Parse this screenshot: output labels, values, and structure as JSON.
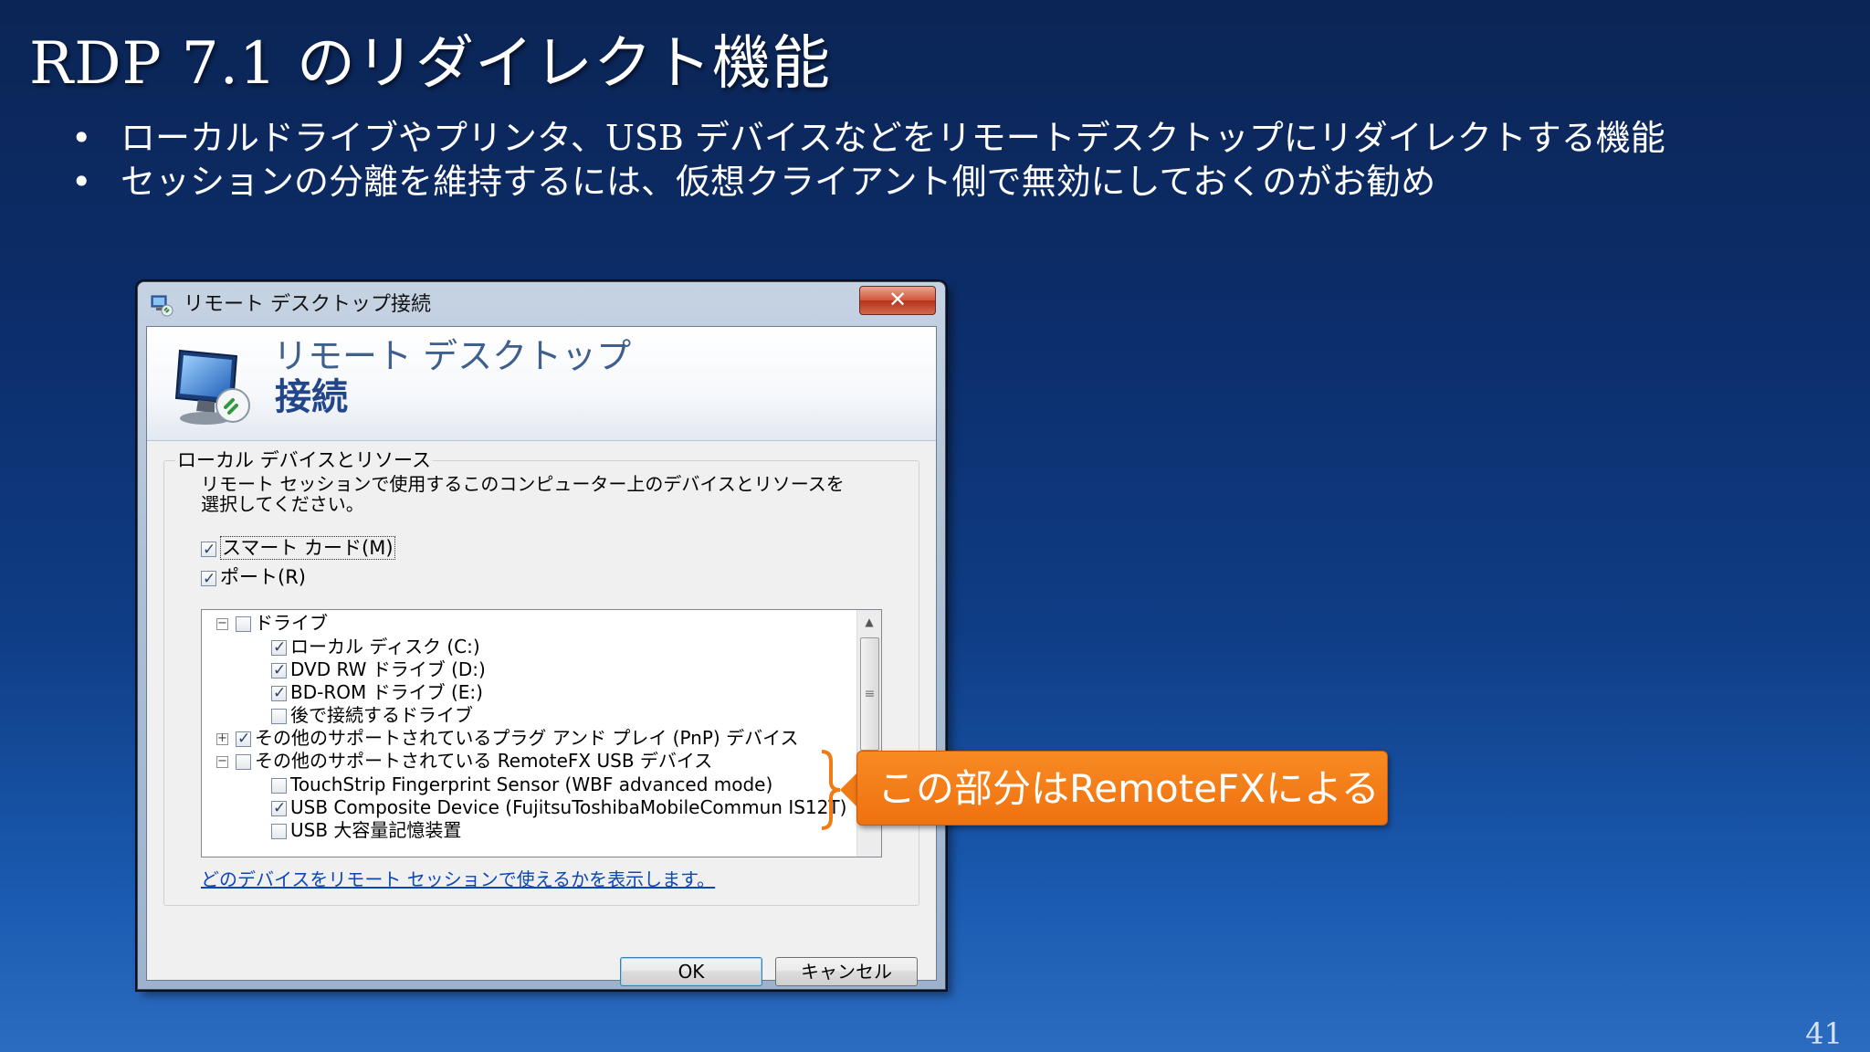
{
  "slide": {
    "title": "RDP 7.1 のリダイレクト機能",
    "bullets": [
      "ローカルドライブやプリンタ、USB デバイスなどをリモートデスクトップにリダイレクトする機能",
      "セッションの分離を維持するには、仮想クライアント側で無効にしておくのがお勧め"
    ],
    "page_number": "41",
    "callout_text": "この部分はRemoteFXによる"
  },
  "dialog": {
    "title": "リモート デスクトップ接続",
    "close_label": "✕",
    "banner_line1": "リモート デスクトップ",
    "banner_line2": "接続",
    "group_label": "ローカル デバイスとリソース",
    "group_description": "リモート セッションで使用するこのコンピューター上のデバイスとリソースを選択してください。",
    "checkboxes": [
      {
        "label": "スマート カード(M)",
        "checked": true
      },
      {
        "label": "ポート(R)",
        "checked": true
      }
    ],
    "tree": [
      {
        "label": "ドライブ",
        "checked": false,
        "expander": "−",
        "level": 0
      },
      {
        "label": "ローカル ディスク (C:)",
        "checked": true,
        "level": 1
      },
      {
        "label": "DVD RW ドライブ (D:)",
        "checked": true,
        "level": 1
      },
      {
        "label": "BD-ROM ドライブ (E:)",
        "checked": true,
        "level": 1
      },
      {
        "label": "後で接続するドライブ",
        "checked": false,
        "level": 1
      },
      {
        "label": "その他のサポートされているプラグ アンド プレイ (PnP) デバイス",
        "checked": true,
        "expander": "+",
        "level": 0
      },
      {
        "label": "その他のサポートされている RemoteFX USB デバイス",
        "checked": false,
        "expander": "−",
        "level": 0
      },
      {
        "label": "TouchStrip Fingerprint Sensor (WBF advanced mode)",
        "checked": false,
        "level": 1
      },
      {
        "label": "USB Composite Device (FujitsuToshibaMobileCommun IS12T)",
        "checked": true,
        "level": 1
      },
      {
        "label": "USB 大容量記憶装置",
        "checked": false,
        "level": 1
      }
    ],
    "link_text": "どのデバイスをリモート セッションで使えるかを表示します。",
    "ok_label": "OK",
    "cancel_label": "キャンセル"
  }
}
